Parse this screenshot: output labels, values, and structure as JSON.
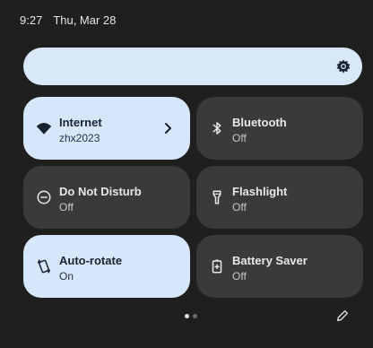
{
  "status_bar": {
    "time": "9:27",
    "date": "Thu, Mar 28"
  },
  "brightness": {
    "icon": "brightness-gear-icon"
  },
  "tiles": [
    {
      "title": "Internet",
      "subtitle": "zhx2023",
      "state": "on",
      "icon": "wifi-icon",
      "has_chevron": true
    },
    {
      "title": "Bluetooth",
      "subtitle": "Off",
      "state": "off",
      "icon": "bluetooth-icon"
    },
    {
      "title": "Do Not Disturb",
      "subtitle": "Off",
      "state": "off",
      "icon": "do-not-disturb-icon"
    },
    {
      "title": "Flashlight",
      "subtitle": "Off",
      "state": "off",
      "icon": "flashlight-icon"
    },
    {
      "title": "Auto-rotate",
      "subtitle": "On",
      "state": "on",
      "icon": "auto-rotate-icon"
    },
    {
      "title": "Battery Saver",
      "subtitle": "Off",
      "state": "off",
      "icon": "battery-saver-icon"
    }
  ],
  "pager": {
    "pages": 2,
    "current": 1
  },
  "colors": {
    "background": "#1f1f1f",
    "tile_on": "#d6e7fb",
    "tile_off": "#3a3a3a",
    "brightness_bar": "#d8e8f8"
  }
}
